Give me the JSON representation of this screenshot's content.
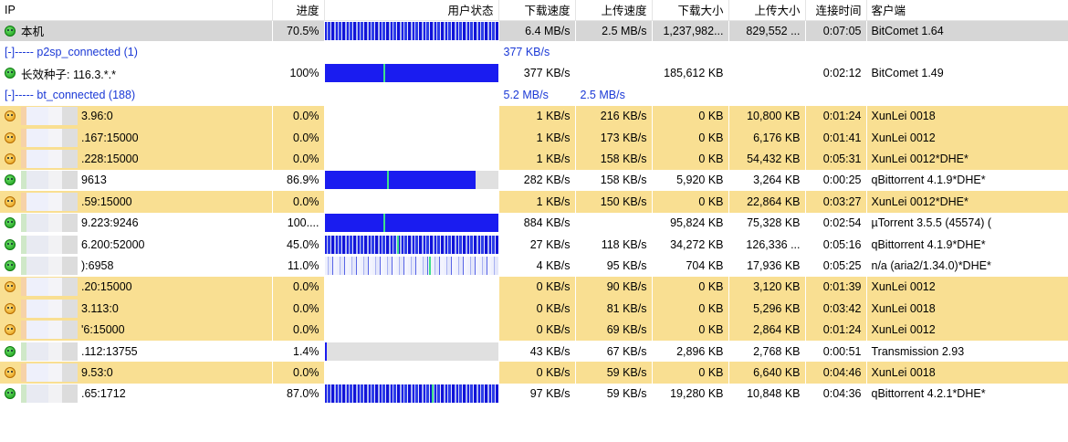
{
  "columns": {
    "ip": "IP",
    "progress": "进度",
    "state": "用户状态",
    "down_speed": "下载速度",
    "up_speed": "上传速度",
    "down_size": "下载大小",
    "up_size": "上传大小",
    "conn_time": "连接时间",
    "client": "客户端"
  },
  "rows": [
    {
      "kind": "peer",
      "style": "sel",
      "face": "ok",
      "blur": false,
      "ip": "本机",
      "progress": "70.5%",
      "bar": "noise",
      "fill": 0.705,
      "marker": null,
      "down_speed": "6.4 MB/s",
      "up_speed": "2.5 MB/s",
      "down_size": "1,237,982...",
      "up_size": "829,552 ...",
      "conn_time": "0:07:05",
      "client": "BitComet 1.64"
    },
    {
      "kind": "group",
      "ip": "[-]----- p2sp_connected (1)",
      "down_speed": "377 KB/s",
      "up_speed": ""
    },
    {
      "kind": "peer",
      "style": "plain",
      "face": "ok",
      "blur": false,
      "ip": "长效种子: 116.3.*.*",
      "progress": "100%",
      "bar": "full",
      "fill": 1.0,
      "marker": 0.34,
      "down_speed": "377 KB/s",
      "up_speed": "",
      "down_size": "185,612 KB",
      "up_size": "",
      "conn_time": "0:02:12",
      "client": "BitComet 1.49"
    },
    {
      "kind": "group",
      "ip": "[-]----- bt_connected (188)",
      "down_speed": "5.2 MB/s",
      "up_speed": "2.5 MB/s"
    },
    {
      "kind": "peer",
      "style": "hl",
      "face": "sad",
      "blur": true,
      "ip": "3.96:0",
      "progress": "0.0%",
      "bar": "none",
      "fill": 0,
      "marker": null,
      "down_speed": "1 KB/s",
      "up_speed": "216 KB/s",
      "down_size": "0 KB",
      "up_size": "10,800 KB",
      "conn_time": "0:01:24",
      "client": "XunLei 0018"
    },
    {
      "kind": "peer",
      "style": "hl",
      "face": "sad",
      "blur": true,
      "ip": ".167:15000",
      "progress": "0.0%",
      "bar": "none",
      "fill": 0,
      "marker": null,
      "down_speed": "1 KB/s",
      "up_speed": "173 KB/s",
      "down_size": "0 KB",
      "up_size": "6,176 KB",
      "conn_time": "0:01:41",
      "client": "XunLei 0012"
    },
    {
      "kind": "peer",
      "style": "hl",
      "face": "sad",
      "blur": true,
      "ip": ".228:15000",
      "progress": "0.0%",
      "bar": "none",
      "fill": 0,
      "marker": null,
      "down_speed": "1 KB/s",
      "up_speed": "158 KB/s",
      "down_size": "0 KB",
      "up_size": "54,432 KB",
      "conn_time": "0:05:31",
      "client": "XunLei 0012*DHE*"
    },
    {
      "kind": "peer",
      "style": "plain",
      "face": "ok",
      "blur": true,
      "ip": "9613",
      "progress": "86.9%",
      "bar": "partial",
      "fill": 0.869,
      "marker": 0.36,
      "down_speed": "282 KB/s",
      "up_speed": "158 KB/s",
      "down_size": "5,920 KB",
      "up_size": "3,264 KB",
      "conn_time": "0:00:25",
      "client": "qBittorrent 4.1.9*DHE*"
    },
    {
      "kind": "peer",
      "style": "hl",
      "face": "sad",
      "blur": true,
      "ip": ".59:15000",
      "progress": "0.0%",
      "bar": "none",
      "fill": 0,
      "marker": null,
      "down_speed": "1 KB/s",
      "up_speed": "150 KB/s",
      "down_size": "0 KB",
      "up_size": "22,864 KB",
      "conn_time": "0:03:27",
      "client": "XunLei 0012*DHE*"
    },
    {
      "kind": "peer",
      "style": "plain",
      "face": "ok",
      "blur": true,
      "ip": "9.223:9246",
      "progress": "100....",
      "bar": "full",
      "fill": 1.0,
      "marker": 0.34,
      "down_speed": "884 KB/s",
      "up_speed": "",
      "down_size": "95,824 KB",
      "up_size": "75,328 KB",
      "conn_time": "0:02:54",
      "client": "µTorrent 3.5.5 (45574) ("
    },
    {
      "kind": "peer",
      "style": "plain",
      "face": "ok",
      "blur": true,
      "ip": "6.200:52000",
      "progress": "45.0%",
      "bar": "noise",
      "fill": 0.45,
      "marker": 0.42,
      "down_speed": "27 KB/s",
      "up_speed": "118 KB/s",
      "down_size": "34,272 KB",
      "up_size": "126,336 ...",
      "conn_time": "0:05:16",
      "client": "qBittorrent 4.1.9*DHE*"
    },
    {
      "kind": "peer",
      "style": "plain",
      "face": "ok",
      "blur": true,
      "ip": "):6958",
      "progress": "11.0%",
      "bar": "lightnoise",
      "fill": 0.11,
      "marker": 0.6,
      "down_speed": "4 KB/s",
      "up_speed": "95 KB/s",
      "down_size": "704 KB",
      "up_size": "17,936 KB",
      "conn_time": "0:05:25",
      "client": "n/a (aria2/1.34.0)*DHE*"
    },
    {
      "kind": "peer",
      "style": "hl",
      "face": "sad",
      "blur": true,
      "ip": ".20:15000",
      "progress": "0.0%",
      "bar": "none",
      "fill": 0,
      "marker": null,
      "down_speed": "0 KB/s",
      "up_speed": "90 KB/s",
      "down_size": "0 KB",
      "up_size": "3,120 KB",
      "conn_time": "0:01:39",
      "client": "XunLei 0012"
    },
    {
      "kind": "peer",
      "style": "hl",
      "face": "sad",
      "blur": true,
      "ip": "3.113:0",
      "progress": "0.0%",
      "bar": "none",
      "fill": 0,
      "marker": null,
      "down_speed": "0 KB/s",
      "up_speed": "81 KB/s",
      "down_size": "0 KB",
      "up_size": "5,296 KB",
      "conn_time": "0:03:42",
      "client": "XunLei 0018"
    },
    {
      "kind": "peer",
      "style": "hl",
      "face": "sad",
      "blur": true,
      "ip": "'6:15000",
      "progress": "0.0%",
      "bar": "none",
      "fill": 0,
      "marker": null,
      "down_speed": "0 KB/s",
      "up_speed": "69 KB/s",
      "down_size": "0 KB",
      "up_size": "2,864 KB",
      "conn_time": "0:01:24",
      "client": "XunLei 0012"
    },
    {
      "kind": "peer",
      "style": "plain",
      "face": "ok",
      "blur": true,
      "ip": ".112:13755",
      "progress": "1.4%",
      "bar": "partial",
      "fill": 0.014,
      "marker": null,
      "down_speed": "43 KB/s",
      "up_speed": "67 KB/s",
      "down_size": "2,896 KB",
      "up_size": "2,768 KB",
      "conn_time": "0:00:51",
      "client": "Transmission 2.93"
    },
    {
      "kind": "peer",
      "style": "hl",
      "face": "sad",
      "blur": true,
      "ip": "9.53:0",
      "progress": "0.0%",
      "bar": "none",
      "fill": 0,
      "marker": null,
      "down_speed": "0 KB/s",
      "up_speed": "59 KB/s",
      "down_size": "0 KB",
      "up_size": "6,640 KB",
      "conn_time": "0:04:46",
      "client": "XunLei 0018"
    },
    {
      "kind": "peer",
      "style": "plain",
      "face": "ok",
      "blur": true,
      "ip": ".65:1712",
      "progress": "87.0%",
      "bar": "noise",
      "fill": 0.87,
      "marker": 0.62,
      "down_speed": "97 KB/s",
      "up_speed": "59 KB/s",
      "down_size": "19,280 KB",
      "up_size": "10,848 KB",
      "conn_time": "0:04:36",
      "client": "qBittorrent 4.2.1*DHE*"
    }
  ]
}
